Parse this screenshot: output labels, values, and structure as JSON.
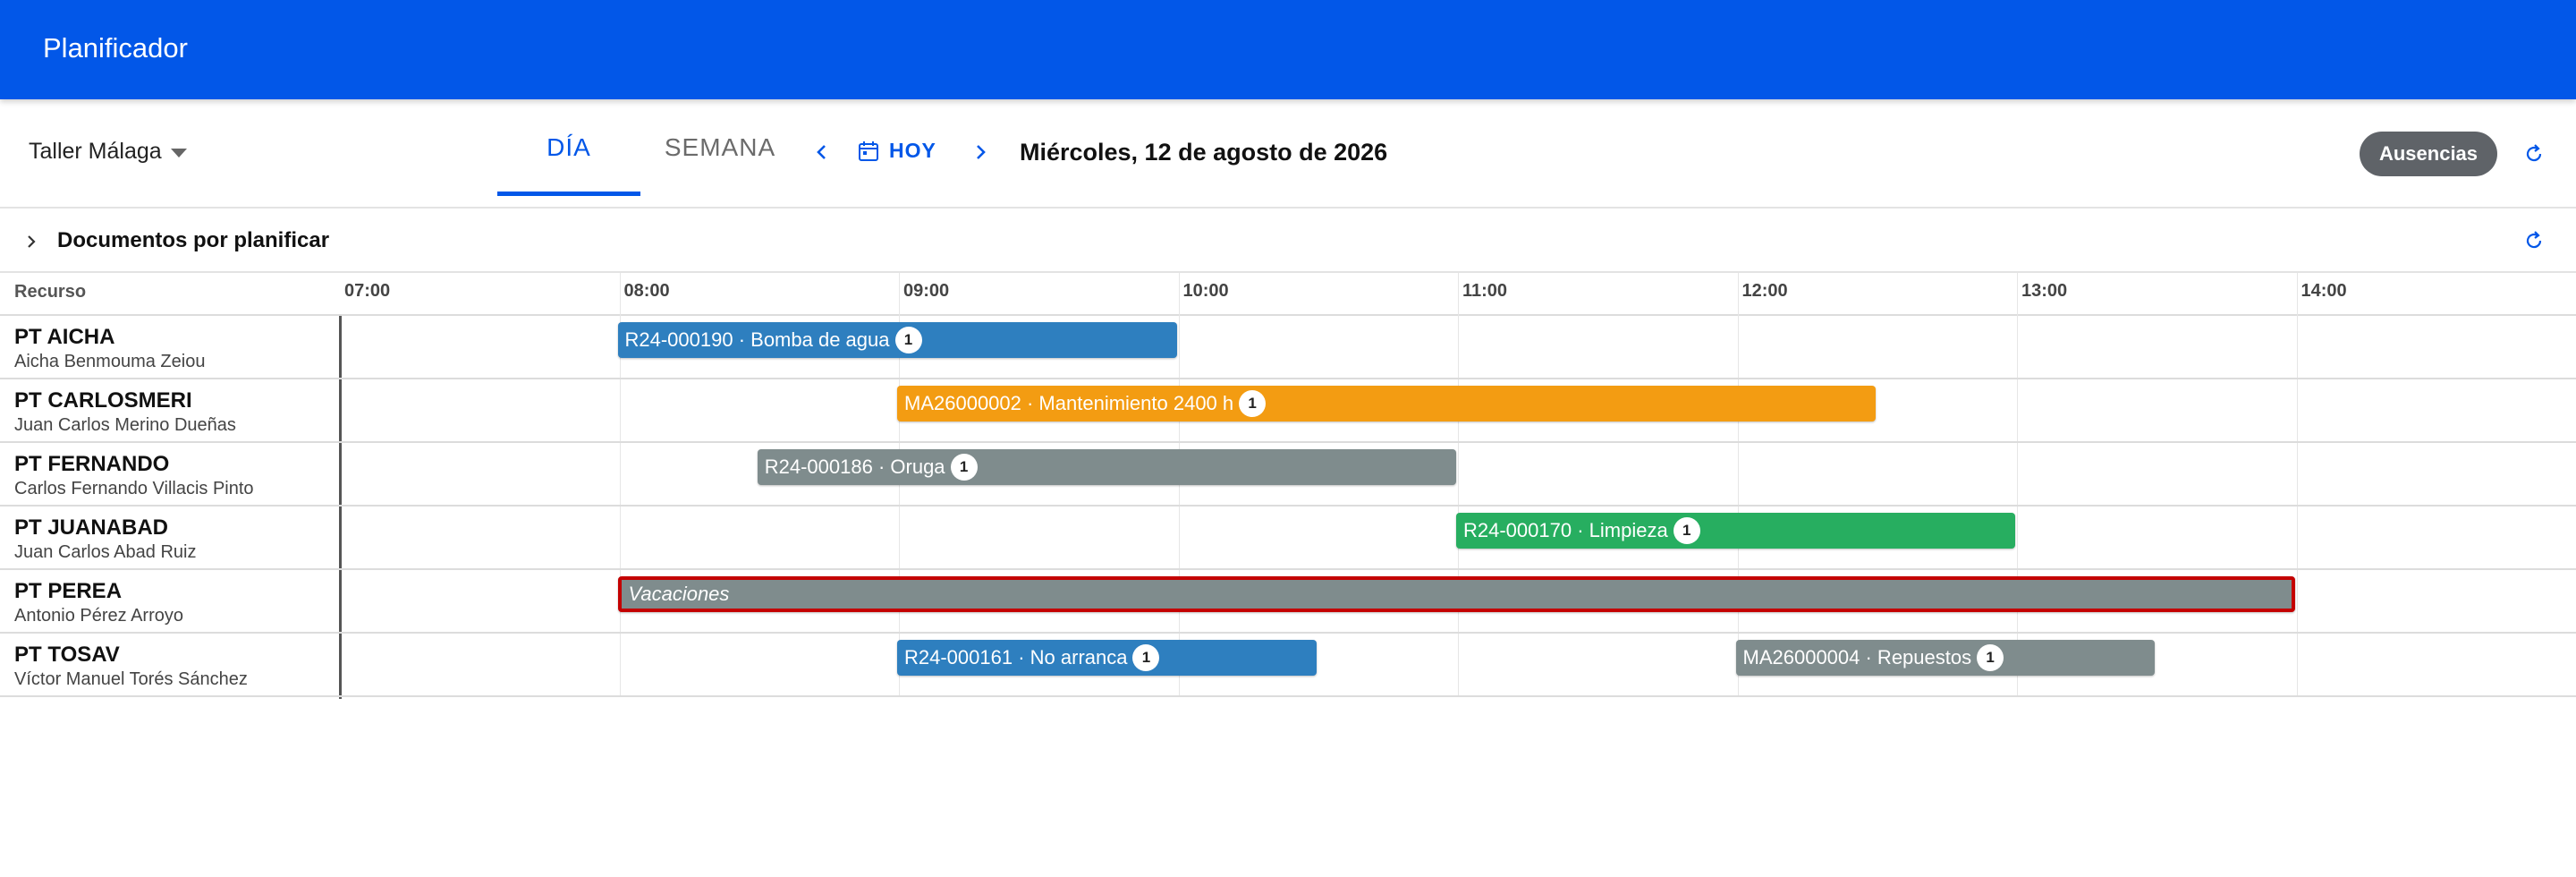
{
  "appbar": {
    "title": "Planificador"
  },
  "toolbar": {
    "site": "Taller Málaga",
    "tab_day": "DÍA",
    "tab_week": "SEMANA",
    "today": "HOY",
    "date": "Miércoles, 12 de agosto de 2026",
    "absences_button": "Ausencias"
  },
  "pending": {
    "label": "Documentos por planificar"
  },
  "grid": {
    "resource_header": "Recurso",
    "hours": [
      "07:00",
      "08:00",
      "09:00",
      "10:00",
      "11:00",
      "12:00",
      "13:00",
      "14:00"
    ],
    "rows": [
      {
        "name": "PT AICHA",
        "full": "Aicha Benmouma Zeiou"
      },
      {
        "name": "PT CARLOSMERI",
        "full": "Juan Carlos Merino Dueñas"
      },
      {
        "name": "PT FERNANDO",
        "full": "Carlos Fernando Villacis Pinto"
      },
      {
        "name": "PT JUANABAD",
        "full": "Juan Carlos Abad Ruiz"
      },
      {
        "name": "PT PEREA",
        "full": "Antonio Pérez Arroyo"
      },
      {
        "name": "PT TOSAV",
        "full": "Víctor Manuel Torés Sánchez"
      }
    ]
  },
  "events": [
    {
      "row": 0,
      "start": "08:00",
      "end": "10:00",
      "label": "R24-000190 · Bomba de agua",
      "badge": "1",
      "color": "#2E7FBF"
    },
    {
      "row": 1,
      "start": "09:00",
      "end": "12:30",
      "label": "MA26000002 · Mantenimiento 2400 h",
      "badge": "1",
      "color": "#F39C12"
    },
    {
      "row": 2,
      "start": "08:30",
      "end": "11:00",
      "label": "R24-000186 · Oruga",
      "badge": "1",
      "color": "#7F8C8D"
    },
    {
      "row": 3,
      "start": "11:00",
      "end": "13:00",
      "label": "R24-000170 · Limpieza",
      "badge": "1",
      "color": "#27AE60"
    },
    {
      "row": 4,
      "start": "08:00",
      "end": "14:00",
      "label": "Vacaciones",
      "badge": "",
      "color": "#7F8C8D",
      "absence": true
    },
    {
      "row": 5,
      "start": "09:00",
      "end": "10:30",
      "label": "R24-000161 · No arranca",
      "badge": "1",
      "color": "#2E7FBF"
    },
    {
      "row": 5,
      "start": "12:00",
      "end": "13:30",
      "label": "MA26000004 · Repuestos",
      "badge": "1",
      "color": "#7F8C8D"
    }
  ],
  "colors": {
    "brand": "#0257E8",
    "absence_border": "#C40000"
  },
  "icons": [
    "chevron-left-icon",
    "calendar-icon",
    "chevron-right-icon",
    "refresh-icon",
    "chevron-right-expand-icon",
    "caret-down-icon"
  ]
}
